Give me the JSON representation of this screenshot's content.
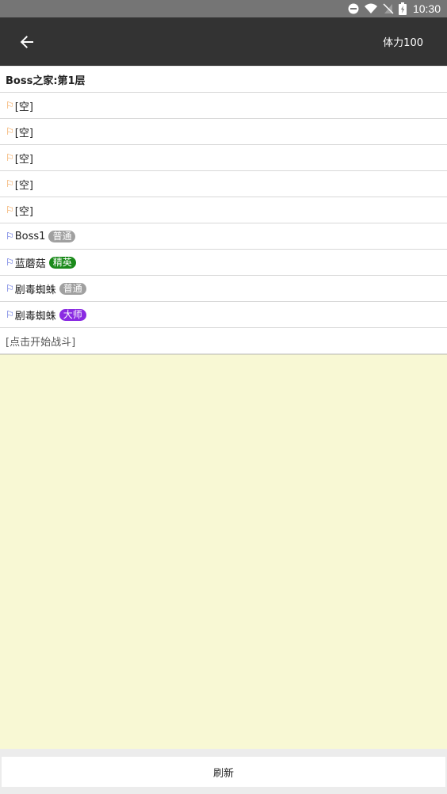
{
  "status_bar": {
    "time": "10:30",
    "icons": [
      "do-not-disturb-icon",
      "wifi-icon",
      "no-sim-icon",
      "battery-charging-icon"
    ]
  },
  "app_bar": {
    "back_icon": "arrow-back-icon",
    "stamina_label": "体力100"
  },
  "dungeon": {
    "title": "Boss之家:第1层",
    "slots": [
      {
        "label": "[空]",
        "flag": "orange",
        "badge": null
      },
      {
        "label": "[空]",
        "flag": "orange",
        "badge": null
      },
      {
        "label": "[空]",
        "flag": "orange",
        "badge": null
      },
      {
        "label": "[空]",
        "flag": "orange",
        "badge": null
      },
      {
        "label": "[空]",
        "flag": "orange",
        "badge": null
      },
      {
        "label": "Boss1",
        "flag": "blue",
        "badge": {
          "text": "普通",
          "color": "#a0a0a0"
        }
      },
      {
        "label": "蓝蘑菇",
        "flag": "blue",
        "badge": {
          "text": "精英",
          "color": "#1a8a1a"
        }
      },
      {
        "label": "剧毒蜘蛛",
        "flag": "blue",
        "badge": {
          "text": "普通",
          "color": "#a0a0a0"
        }
      },
      {
        "label": "剧毒蜘蛛",
        "flag": "blue",
        "badge": {
          "text": "大师",
          "color": "#8a2be2"
        }
      }
    ],
    "start_battle_label": "[点击开始战斗]"
  },
  "footer": {
    "refresh_label": "刷新"
  },
  "colors": {
    "flag_empty": "#f0963c",
    "flag_enemy": "#3c4fd6",
    "log_background": "#f8f8d4",
    "app_bar": "#333333"
  }
}
